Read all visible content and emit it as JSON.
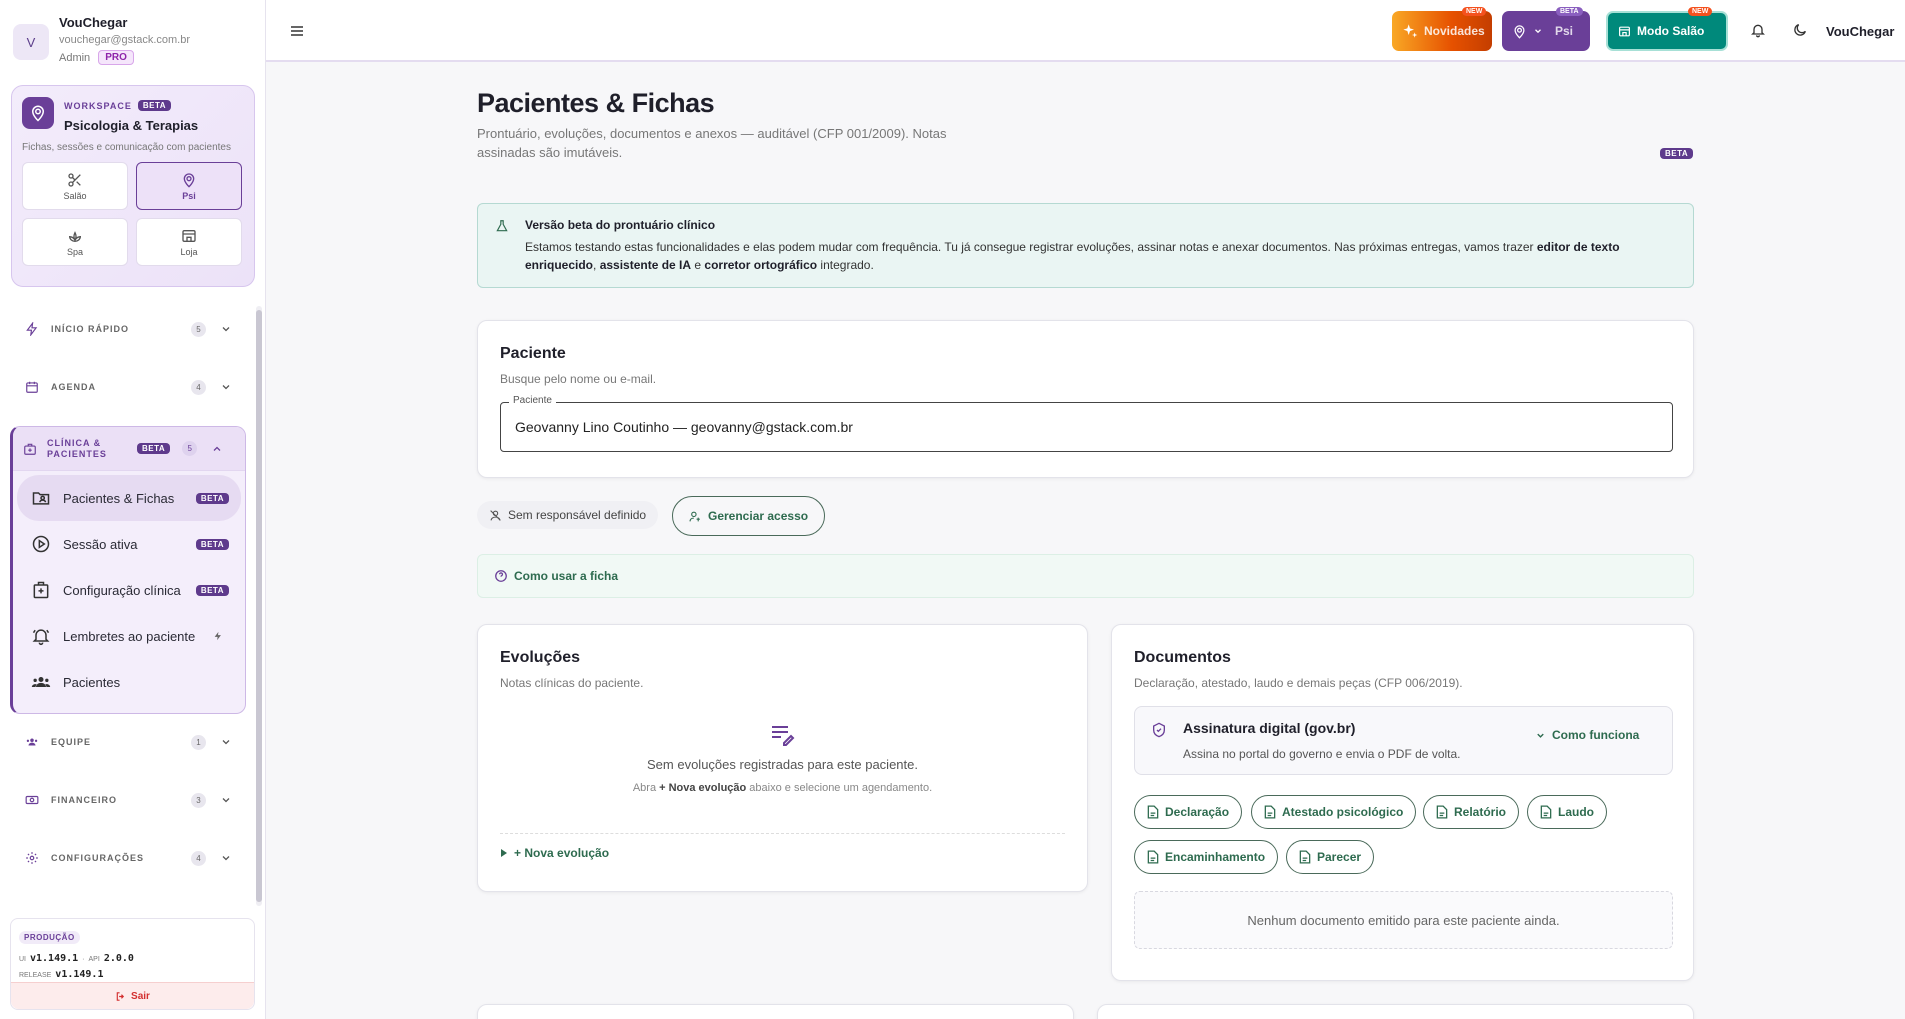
{
  "user": {
    "initial": "V",
    "name": "VouChegar",
    "email": "vouchegar@gstack.com.br",
    "role": "Admin",
    "plan": "PRO"
  },
  "workspace": {
    "label": "WORKSPACE",
    "badge": "BETA",
    "title": "Psicologia & Terapias",
    "subtitle": "Fichas, sessões e comunicação com pacientes",
    "tiles": [
      {
        "label": "Salão",
        "icon": "scissors-icon"
      },
      {
        "label": "Psi",
        "icon": "brain-pin-icon",
        "active": true
      },
      {
        "label": "Spa",
        "icon": "lotus-icon"
      },
      {
        "label": "Loja",
        "icon": "store-icon"
      }
    ]
  },
  "nav": {
    "inicio": {
      "label": "INÍCIO RÁPIDO",
      "count": "5"
    },
    "agenda": {
      "label": "AGENDA",
      "count": "4"
    },
    "clinica": {
      "label": "CLÍNICA & PACIENTES",
      "badge": "BETA",
      "count": "5",
      "items": [
        {
          "label": "Pacientes & Fichas",
          "badge": "BETA"
        },
        {
          "label": "Sessão ativa",
          "badge": "BETA"
        },
        {
          "label": "Configuração clínica",
          "badge": "BETA"
        },
        {
          "label": "Lembretes ao paciente"
        },
        {
          "label": "Pacientes"
        }
      ]
    },
    "equipe": {
      "label": "EQUIPE",
      "count": "1"
    },
    "financeiro": {
      "label": "FINANCEIRO",
      "count": "3"
    },
    "config": {
      "label": "CONFIGURAÇÕES",
      "count": "4"
    }
  },
  "footer": {
    "env": "PRODUÇÃO",
    "ui_label": "UI",
    "ui_version": "v1.149.1",
    "api_label": "API",
    "api_version": "2.0.0",
    "release_label": "RELEASE",
    "release_version": "v1.149.1",
    "logout": "Sair"
  },
  "topbar": {
    "novidades": "Novidades",
    "novidades_badge": "NEW",
    "psi": "Psi",
    "psi_badge": "BETA",
    "modo_salao": "Modo Salão",
    "modo_badge": "NEW",
    "user": "VouChegar",
    "colors": {
      "novidades": "#f57c00",
      "psi": "#6a3f98",
      "modo": "#00897b"
    }
  },
  "page": {
    "title": "Pacientes & Fichas",
    "description": "Prontuário, evoluções, documentos e anexos — auditável (CFP 001/2009). Notas assinadas são imutáveis.",
    "badge": "BETA"
  },
  "alert": {
    "title": "Versão beta do prontuário clínico",
    "body_1": "Estamos testando estas funcionalidades e elas podem mudar com frequência. Tu já consegue registrar evoluções, assinar notas e anexar documentos. Nas próximas entregas, vamos trazer ",
    "b1": "editor de texto enriquecido",
    "sep1": ", ",
    "b2": "assistente de IA",
    "sep2": " e ",
    "b3": "corretor ortográfico",
    "body_end": " integrado."
  },
  "patient": {
    "title": "Paciente",
    "subtitle": "Busque pelo nome ou e-mail.",
    "field_label": "Paciente",
    "value": "Geovanny Lino Coutinho — geovanny@gstack.com.br"
  },
  "access": {
    "none": "Sem responsável definido",
    "manage": "Gerenciar acesso"
  },
  "howto": "Como usar a ficha",
  "evolucoes": {
    "title": "Evoluções",
    "subtitle": "Notas clínicas do paciente.",
    "empty": "Sem evoluções registradas para este paciente.",
    "hint_pre": "Abra ",
    "hint_bold": "+ Nova evolução",
    "hint_post": " abaixo e selecione um agendamento.",
    "add": "+ Nova evolução"
  },
  "documentos": {
    "title": "Documentos",
    "subtitle": "Declaração, atestado, laudo e demais peças (CFP 006/2019).",
    "sig_title": "Assinatura digital (gov.br)",
    "sig_sub": "Assina no portal do governo e envia o PDF de volta.",
    "sig_how": "Como funciona",
    "buttons": [
      "Declaração",
      "Atestado psicológico",
      "Relatório",
      "Laudo",
      "Encaminhamento",
      "Parecer"
    ],
    "empty": "Nenhum documento emitido para este paciente ainda."
  }
}
